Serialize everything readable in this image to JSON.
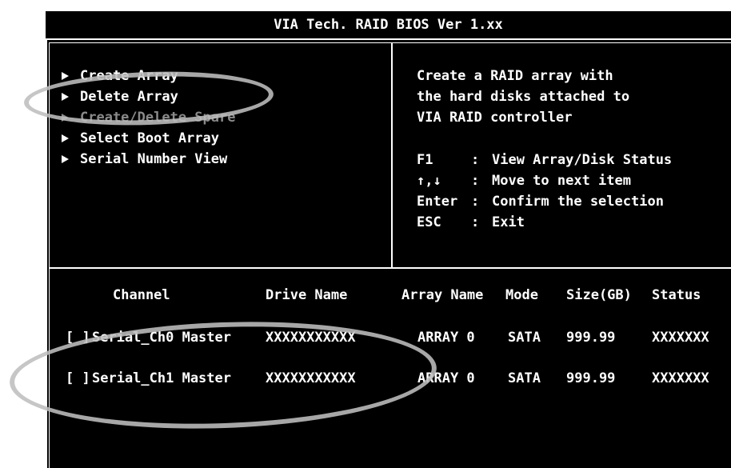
{
  "bios": {
    "title": "VIA Tech. RAID BIOS Ver 1.xx"
  },
  "menu": {
    "items": [
      {
        "label": "Create Array",
        "enabled": true
      },
      {
        "label": "Delete Array",
        "enabled": true
      },
      {
        "label": "Create/Delete Spare",
        "enabled": false
      },
      {
        "label": "Select Boot Array",
        "enabled": true
      },
      {
        "label": "Serial Number View",
        "enabled": true
      }
    ]
  },
  "help": {
    "lines": [
      "Create a RAID array with",
      "the hard disks attached to",
      "VIA RAID controller"
    ],
    "keys": [
      {
        "key": "F1",
        "sep": ":",
        "desc": "View Array/Disk Status"
      },
      {
        "key": "↑,↓",
        "sep": ":",
        "desc": "Move to next item"
      },
      {
        "key": "Enter",
        "sep": ":",
        "desc": "Confirm the selection"
      },
      {
        "key": "ESC",
        "sep": ":",
        "desc": "Exit"
      }
    ]
  },
  "table": {
    "headers": {
      "channel": "Channel",
      "drive_name": "Drive Name",
      "array_name": "Array Name",
      "mode": "Mode",
      "size": "Size(GB)",
      "status": "Status"
    },
    "rows": [
      {
        "select": "[ ]",
        "channel": "Serial_Ch0 Master",
        "drive_name": "XXXXXXXXXXX",
        "array_name": "ARRAY 0",
        "mode": "SATA",
        "size": "999.99",
        "status": "XXXXXXX"
      },
      {
        "select": "[ ]",
        "channel": "Serial_Ch1 Master",
        "drive_name": "XXXXXXXXXXX",
        "array_name": "ARRAY 0",
        "mode": "SATA",
        "size": "999.99",
        "status": "XXXXXXX"
      }
    ]
  },
  "colors": {
    "background": "#000000",
    "foreground": "#ffffff",
    "disabled": "#8a8a8a",
    "highlight_oval": "#bebebe"
  }
}
